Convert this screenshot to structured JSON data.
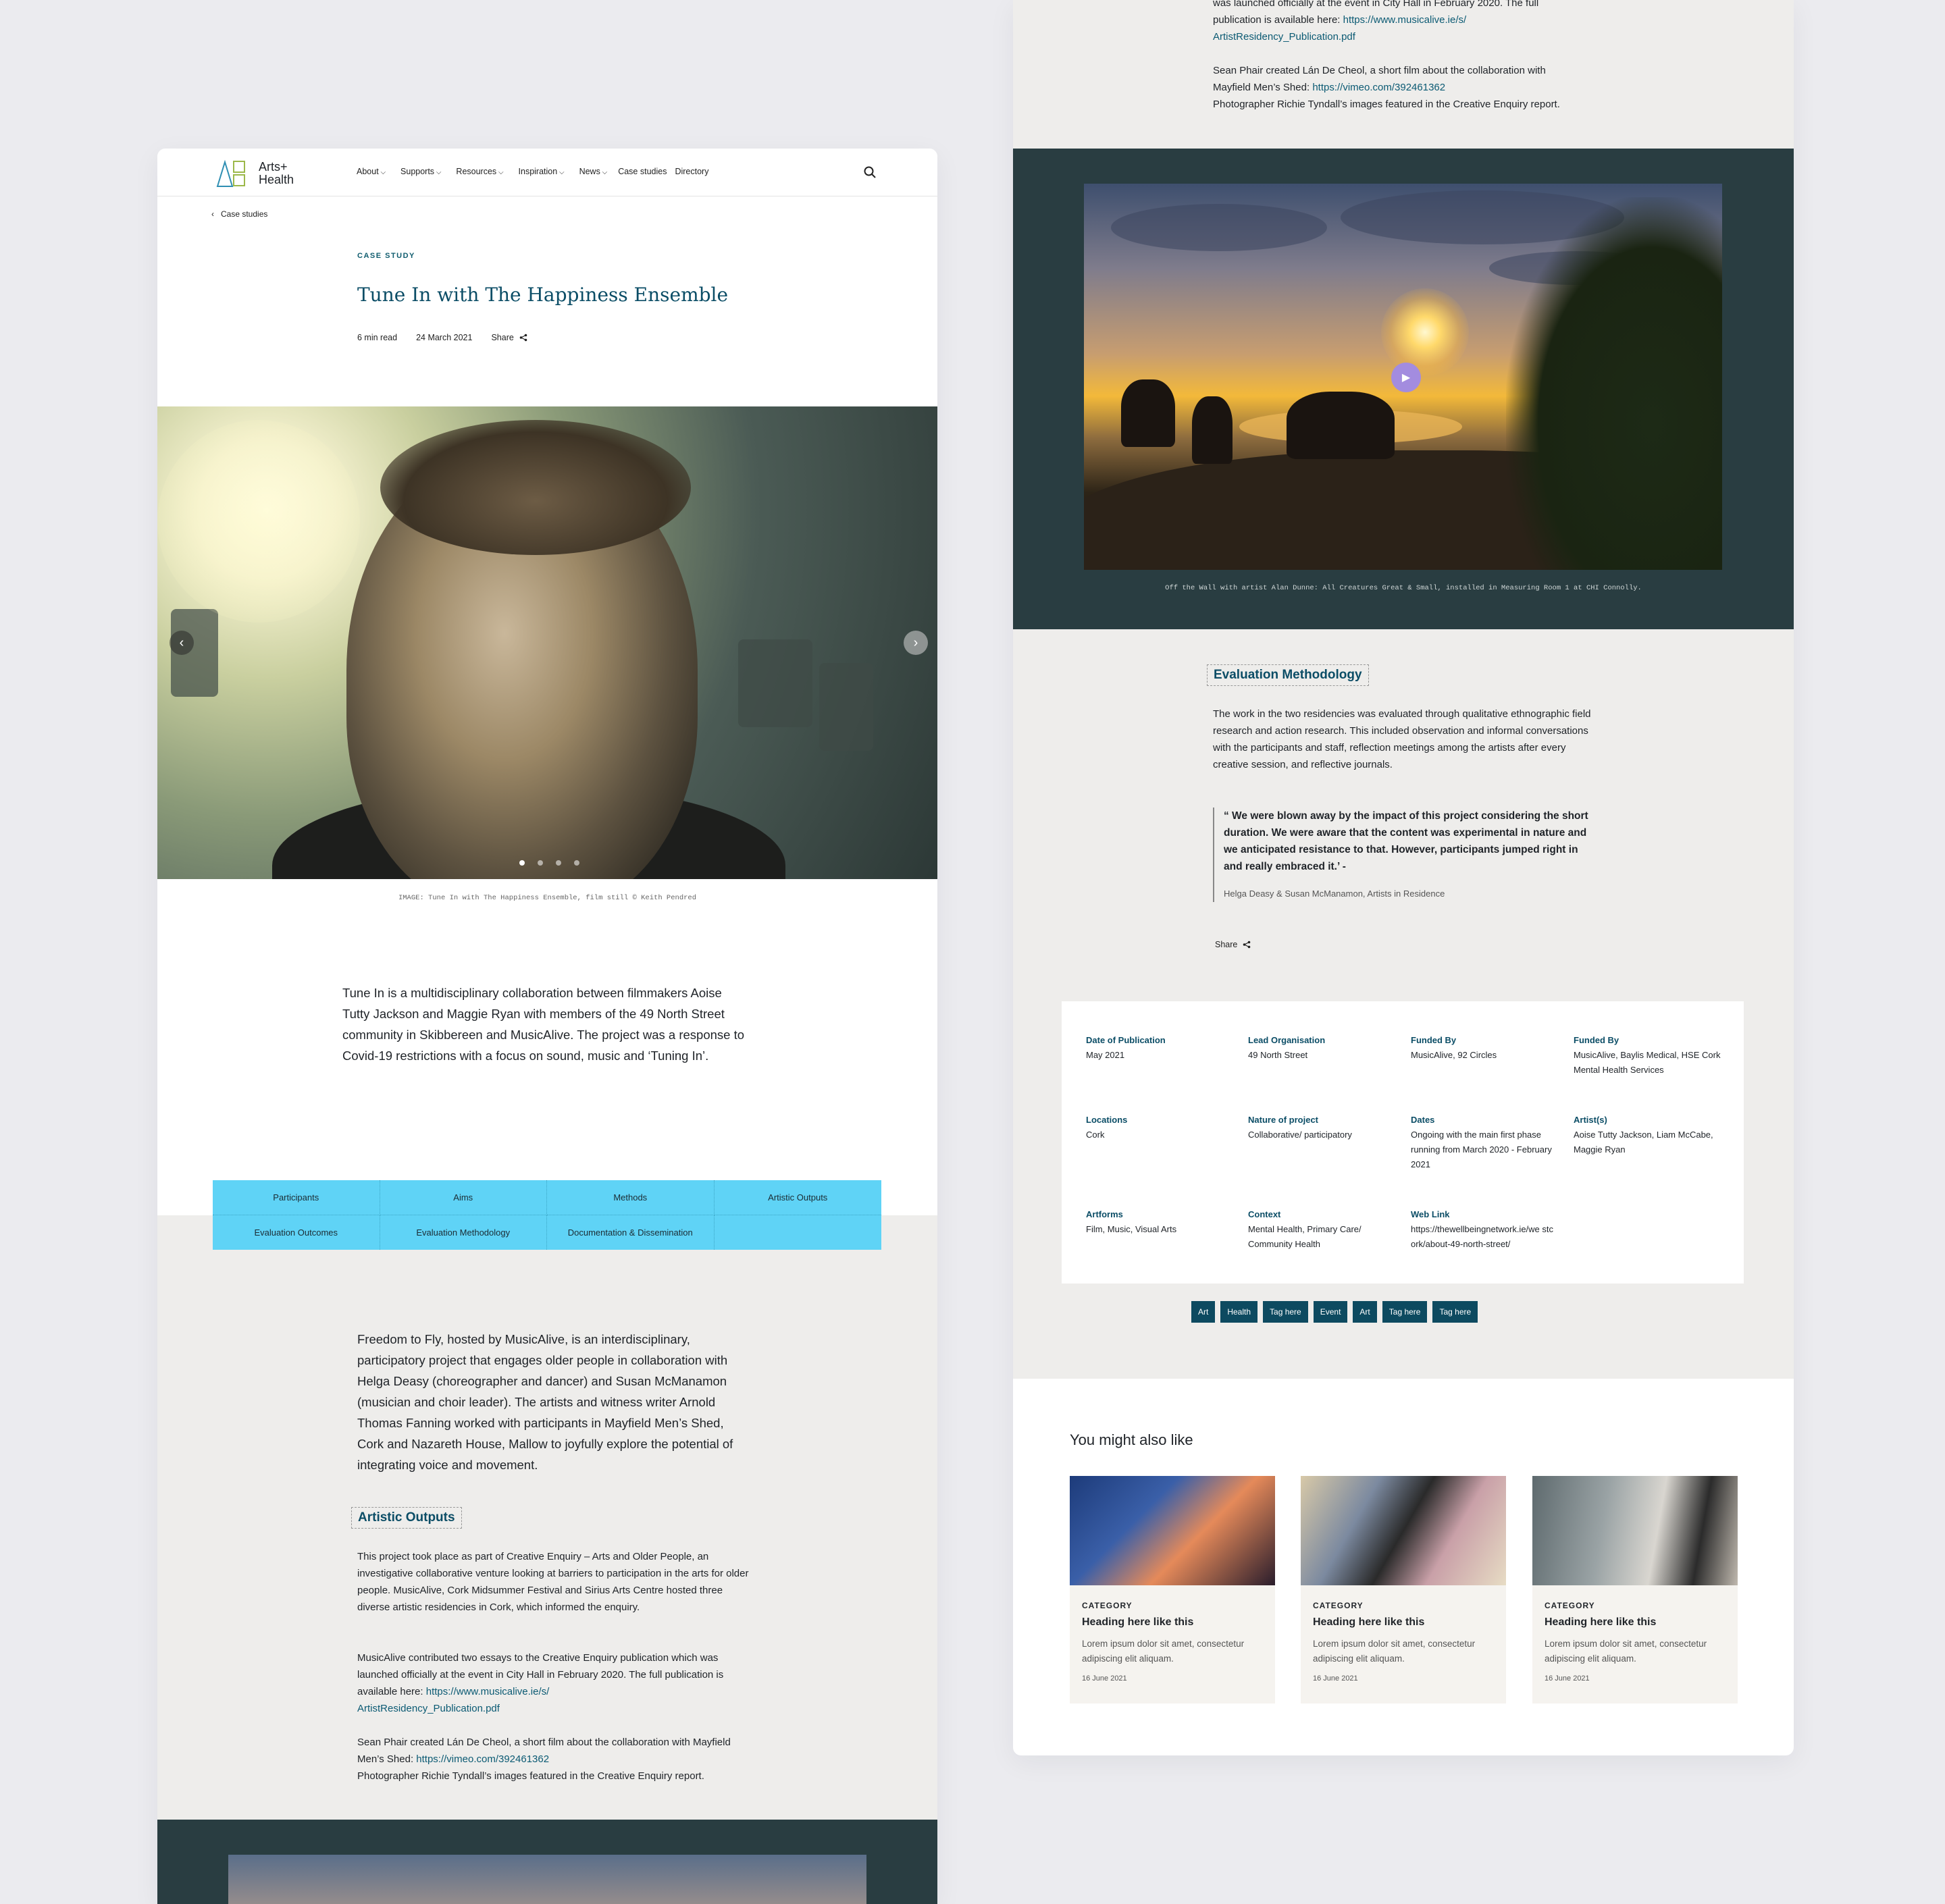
{
  "brand": {
    "name_line1": "Arts+",
    "name_line2": "Health"
  },
  "nav": [
    "About",
    "Supports",
    "Resources",
    "Inspiration",
    "News",
    "Case studies",
    "Directory"
  ],
  "back_label": "Case studies",
  "article": {
    "eyebrow": "CASE STUDY",
    "title": "Tune In with The Happiness Ensemble",
    "read_time": "6 min read",
    "date": "24 March 2021",
    "share_label": "Share",
    "hero_caption": "IMAGE: Tune In with The Happiness Ensemble, film still © Keith Pendred",
    "intro": "Tune In is a multidisciplinary collaboration between filmmakers Aoise Tutty Jackson and Maggie Ryan with members of the 49 North Street community in Skibbereen and MusicAlive. The project was a response to Covid-19 restrictions with a focus on sound, music and ‘Tuning In’."
  },
  "tabs": [
    "Participants",
    "Aims",
    "Methods",
    "Artistic Outputs",
    "Evaluation Outcomes",
    "Evaluation Methodology",
    "Documentation & Dissemination",
    ""
  ],
  "freedom_text": "Freedom to Fly, hosted by MusicAlive, is an interdisciplinary, participatory project that engages older people in collaboration with Helga Deasy (choreographer and dancer) and Susan McManamon (musician and choir leader). The artists and witness writer Arnold Thomas Fanning worked with participants in Mayfield Men’s Shed, Cork and Nazareth House, Mallow to joyfully explore the potential of integrating voice and movement.",
  "artistic_outputs": {
    "heading": "Artistic Outputs",
    "p1": "This project took place as part of Creative Enquiry – Arts and Older People, an investigative collaborative venture looking at barriers to participation in the arts for older people. MusicAlive, Cork Midsummer Festival and Sirius Arts Centre hosted three diverse artistic residencies in Cork, which informed the enquiry.",
    "p2_pre": "MusicAlive contributed two essays to the Creative Enquiry publication which was launched officially at the event in City Hall in February 2020. The full publication is available here:",
    "p2_link_a": "https://www.musicalive.ie/s/",
    "p2_link_b": "ArtistResidency_Publication.pdf",
    "p3_pre": "Sean Phair created Lán De Cheol, a short film about the collaboration with Mayfield Men’s Shed:",
    "p3_link": "https://vimeo.com/392461362",
    "p3_post": "Photographer Richie Tyndall’s images featured in the Creative Enquiry report."
  },
  "right_top": {
    "line1": "was launched officially at the event in City Hall in February 2020. The full",
    "line2_pre": "publication is available here:",
    "link_a": "https://www.musicalive.ie/s/",
    "link_b": "ArtistResidency_Publication.pdf",
    "sean": "Sean Phair created Lán De Cheol, a short film about the collaboration with",
    "sean2_pre": "Mayfield Men’s Shed:",
    "vimeo": "https://vimeo.com/392461362",
    "photog": "Photographer Richie Tyndall’s images featured in the Creative Enquiry report."
  },
  "video_caption": "Off the Wall with artist Alan Dunne: All Creatures Great & Small, installed in Measuring Room 1 at CHI Connolly.",
  "evaluation": {
    "heading": "Evaluation Methodology",
    "text": "The work in the two residencies was evaluated through qualitative ethnographic field research and action research. This included observation and informal conversations with the participants and staff, reflection meetings among the artists after every creative session, and reflective journals.",
    "quote": "“ We were blown away by the impact of this project considering the short duration. We were aware that the content was experimental in nature and we anticipated resistance to that. However, participants jumped right in and really embraced it.’ -",
    "quote_by": "Helga Deasy & Susan McManamon, Artists in Residence",
    "share_label": "Share"
  },
  "info": [
    {
      "label": "Date of Publication",
      "value": "May 2021"
    },
    {
      "label": "Lead Organisation",
      "value": "49 North Street"
    },
    {
      "label": "Funded By",
      "value": "MusicAlive, 92 Circles"
    },
    {
      "label": "Funded By",
      "value": "MusicAlive, Baylis Medical, HSE Cork Mental Health Services"
    },
    {
      "label": "Locations",
      "value": "Cork"
    },
    {
      "label": "Nature of project",
      "value": "Collaborative/ participatory"
    },
    {
      "label": "Dates",
      "value": "Ongoing with the main first phase running from March 2020 - February 2021"
    },
    {
      "label": "Artist(s)",
      "value": "Aoise Tutty Jackson, Liam McCabe, Maggie Ryan"
    },
    {
      "label": "Artforms",
      "value": "Film, Music, Visual Arts"
    },
    {
      "label": "Context",
      "value": "Mental Health, Primary Care/ Community Health"
    },
    {
      "label": "Web Link",
      "value": "https://thewellbeingnetwork.ie/we stcork/about-49-north-street/"
    }
  ],
  "tags": [
    "Art",
    "Health",
    "Tag here",
    "Event",
    "Art",
    "Tag here",
    "Tag here"
  ],
  "related": {
    "heading": "You might also like",
    "cards": [
      {
        "category": "CATEGORY",
        "title": "Heading here like this",
        "text": "Lorem ipsum dolor sit amet, consectetur adipiscing elit aliquam.",
        "date": "16 June 2021"
      },
      {
        "category": "CATEGORY",
        "title": "Heading here like this",
        "text": "Lorem ipsum dolor sit amet, consectetur adipiscing elit aliquam.",
        "date": "16 June 2021"
      },
      {
        "category": "CATEGORY",
        "title": "Heading here like this",
        "text": "Lorem ipsum dolor sit amet, consectetur adipiscing elit aliquam.",
        "date": "16 June 2021"
      }
    ]
  },
  "colors": {
    "accent": "#0b4d66",
    "tab_bg": "#5fd3f6",
    "dark_band": "#293d41",
    "tag_bg": "#0d4a60",
    "play": "#a38cdf"
  }
}
